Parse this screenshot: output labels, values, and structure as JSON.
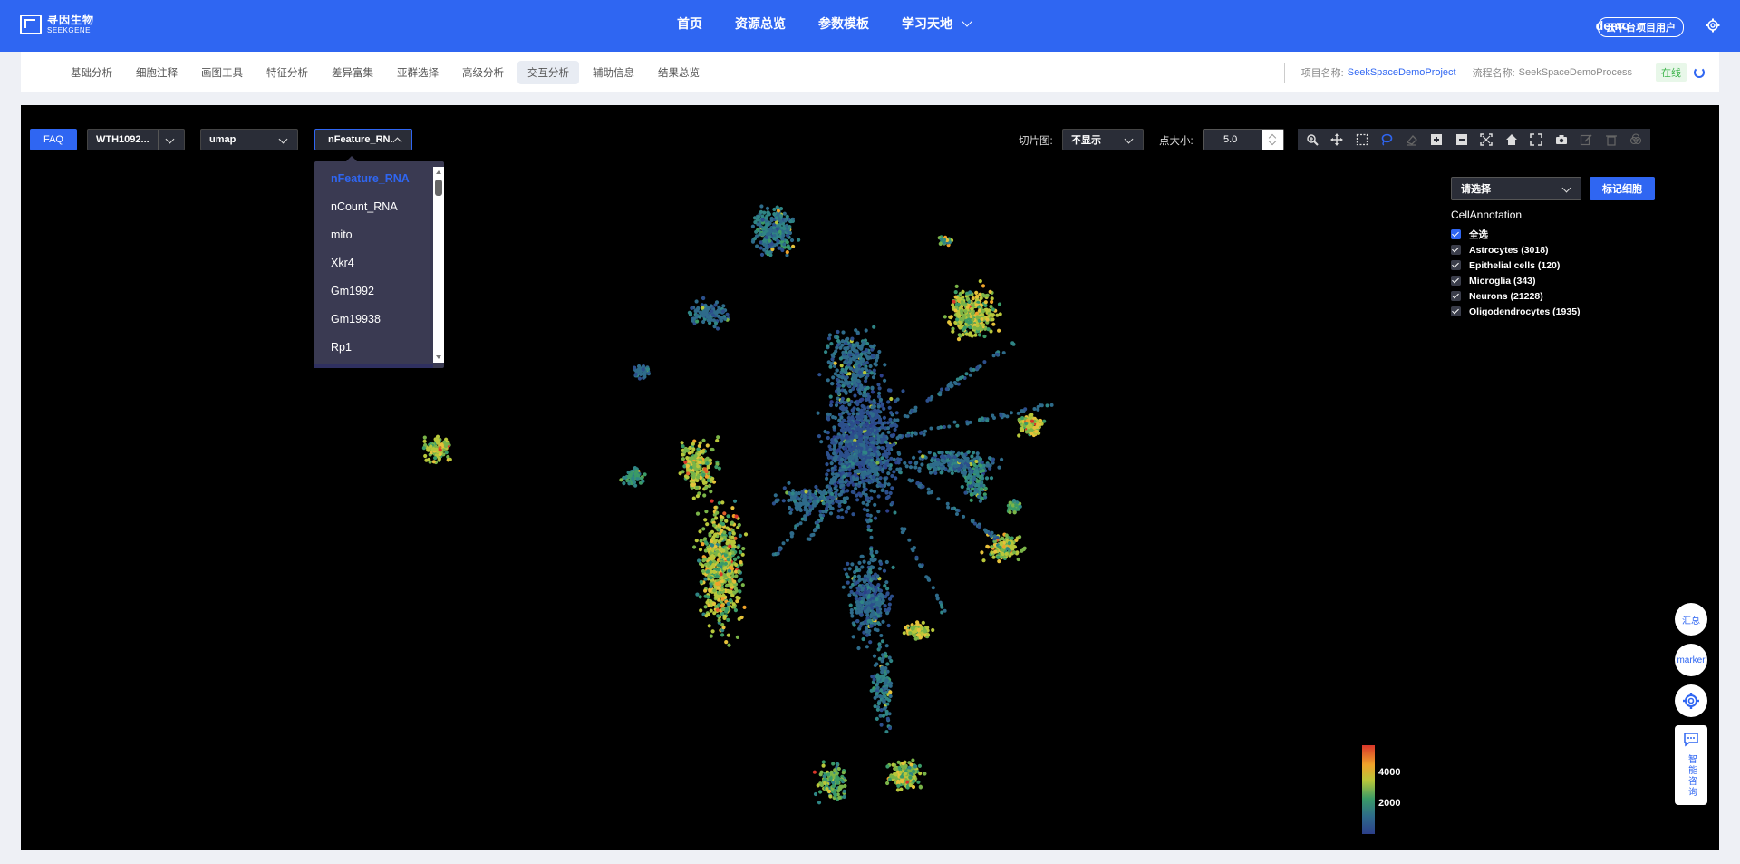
{
  "header": {
    "logo_cn": "寻因生物",
    "logo_en": "SEEKGENE",
    "nav": [
      {
        "label": "首页"
      },
      {
        "label": "资源总览"
      },
      {
        "label": "参数模板"
      },
      {
        "label": "学习天地"
      }
    ],
    "user": "demo",
    "user_badge": "云平台项目用户"
  },
  "subnav": {
    "tabs": [
      "基础分析",
      "细胞注释",
      "画图工具",
      "特征分析",
      "差异富集",
      "亚群选择",
      "高级分析",
      "交互分析",
      "辅助信息",
      "结果总览"
    ],
    "active_tab_index": 7,
    "project_label": "项目名称:",
    "project_name": "SeekSpaceDemoProject",
    "process_label": "流程名称:",
    "process_name": "SeekSpaceDemoProcess",
    "status": "在线"
  },
  "controls": {
    "faq": "FAQ",
    "sample_select": "WTH1092...",
    "reduction_select": "umap",
    "feature_select": "nFeature_RN.",
    "slice_label": "切片图:",
    "slice_value": "不显示",
    "pointsize_label": "点大小:",
    "pointsize_value": "5.0"
  },
  "dropdown": {
    "items": [
      "nFeature_RNA",
      "nCount_RNA",
      "mito",
      "Xkr4",
      "Gm1992",
      "Gm19938",
      "Rp1"
    ],
    "selected_index": 0
  },
  "toolbar": {
    "icons": [
      "zoom-icon",
      "pan-icon",
      "box-select-icon",
      "lasso-select-icon",
      "eraser-icon",
      "zoom-in-icon",
      "zoom-out-icon",
      "autoscale-icon",
      "home-icon",
      "fullscreen-icon",
      "camera-icon",
      "edit-icon",
      "delete-icon",
      "venn-icon"
    ]
  },
  "annotation": {
    "select_placeholder": "请选择",
    "mark_button": "标记细胞",
    "title": "CellAnnotation",
    "items": [
      {
        "label": "全选",
        "checked": true
      },
      {
        "label": "Astrocytes (3018)",
        "checked": true
      },
      {
        "label": "Epithelial cells (120)",
        "checked": true
      },
      {
        "label": "Microglia (343)",
        "checked": true
      },
      {
        "label": "Neurons (21228)",
        "checked": true
      },
      {
        "label": "Oligodendrocytes (1935)",
        "checked": true
      }
    ]
  },
  "colorbar": {
    "ticks": [
      "4000",
      "2000"
    ]
  },
  "floating": {
    "summary": "汇总",
    "marker": "marker",
    "consult": "智能咨询"
  },
  "colors": {
    "primary": "#2f66f2",
    "panel_bg": "#000000",
    "low": "#2c3f8a",
    "mid": "#3b9b66",
    "high": "#d9362a"
  }
}
